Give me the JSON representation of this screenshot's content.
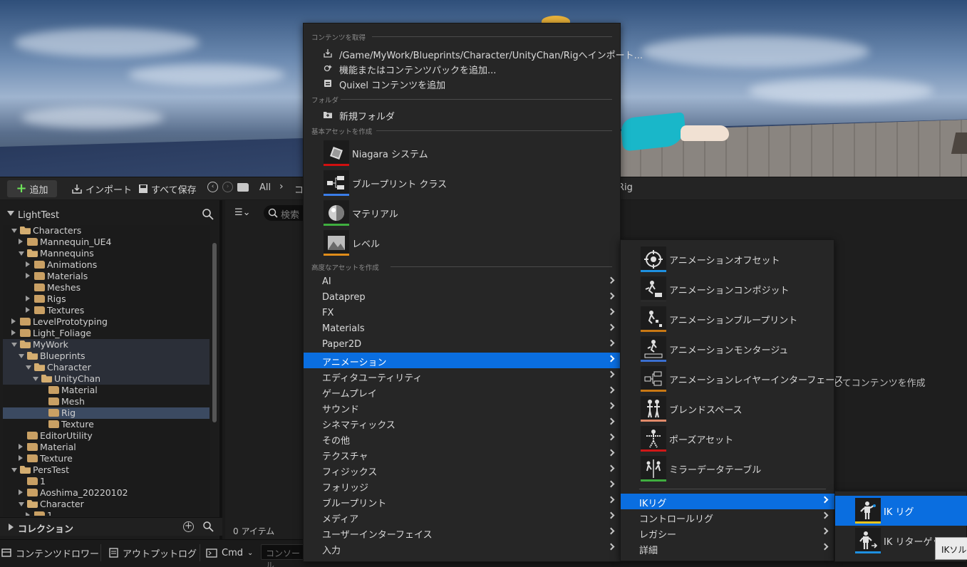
{
  "toolbar": {
    "add_label": "追加",
    "import_label": "インポート",
    "save_all_label": "すべて保存",
    "path_all": "All",
    "path_partial": "コ",
    "path_rig": "Rig"
  },
  "sidebar": {
    "title": "LightTest",
    "tree": [
      {
        "label": "Characters",
        "depth": 2,
        "expander": "down",
        "open": true
      },
      {
        "label": "Mannequin_UE4",
        "depth": 3,
        "expander": "right"
      },
      {
        "label": "Mannequins",
        "depth": 3,
        "expander": "down",
        "open": true
      },
      {
        "label": "Animations",
        "depth": 4,
        "expander": "right"
      },
      {
        "label": "Materials",
        "depth": 4,
        "expander": "right"
      },
      {
        "label": "Meshes",
        "depth": 4,
        "expander": "none"
      },
      {
        "label": "Rigs",
        "depth": 4,
        "expander": "right"
      },
      {
        "label": "Textures",
        "depth": 4,
        "expander": "right"
      },
      {
        "label": "LevelPrototyping",
        "depth": 2,
        "expander": "right"
      },
      {
        "label": "Light_Foliage",
        "depth": 2,
        "expander": "right"
      },
      {
        "label": "MyWork",
        "depth": 2,
        "expander": "down",
        "open": true,
        "highlight": true
      },
      {
        "label": "Blueprints",
        "depth": 3,
        "expander": "down",
        "open": true,
        "highlight": true
      },
      {
        "label": "Character",
        "depth": 4,
        "expander": "down",
        "open": true,
        "highlight": true
      },
      {
        "label": "UnityChan",
        "depth": 5,
        "expander": "down",
        "open": true,
        "highlight": true
      },
      {
        "label": "Material",
        "depth": 6,
        "expander": "none"
      },
      {
        "label": "Mesh",
        "depth": 6,
        "expander": "none"
      },
      {
        "label": "Rig",
        "depth": 6,
        "expander": "none",
        "selected": true
      },
      {
        "label": "Texture",
        "depth": 6,
        "expander": "none"
      },
      {
        "label": "EditorUtility",
        "depth": 3,
        "expander": "none"
      },
      {
        "label": "Material",
        "depth": 3,
        "expander": "right"
      },
      {
        "label": "Texture",
        "depth": 3,
        "expander": "right"
      },
      {
        "label": "PersTest",
        "depth": 2,
        "expander": "down",
        "open": true
      },
      {
        "label": "1",
        "depth": 3,
        "expander": "none"
      },
      {
        "label": "Aoshima_20220102",
        "depth": 3,
        "expander": "right"
      },
      {
        "label": "Character",
        "depth": 3,
        "expander": "down",
        "open": true
      },
      {
        "label": "1",
        "depth": 4,
        "expander": "right"
      }
    ],
    "collection_label": "コレクション"
  },
  "content": {
    "search_placeholder": "検索",
    "items_count": "0 アイテム",
    "bg_hint": "してコンテンツを作成"
  },
  "statusbar": {
    "drawer_label": "コンテンツドロワー",
    "output_log_label": "アウトプットログ",
    "cmd_label": "Cmd",
    "console_placeholder": "コンソール"
  },
  "menu_main": {
    "sec_get": "コンテンツを取得",
    "import_path": "/Game/MyWork/Blueprints/Character/UnityChan/Rigへインポート...",
    "add_feature": "機能またはコンテンツパックを追加...",
    "add_quixel": "Quixel コンテンツを追加",
    "sec_folder": "フォルダ",
    "new_folder": "新規フォルダ",
    "sec_basic": "基本アセットを作成",
    "basic_assets": [
      {
        "label": "Niagara システム",
        "icon": "niagara-icon",
        "color": "#d01010"
      },
      {
        "label": "ブループリント クラス",
        "icon": "blueprint-icon",
        "color": "#3a7de8"
      },
      {
        "label": "マテリアル",
        "icon": "material-icon",
        "color": "#3fae3f"
      },
      {
        "label": "レベル",
        "icon": "level-icon",
        "color": "#e08c1a"
      }
    ],
    "sec_advanced": "高度なアセットを作成",
    "advanced": [
      "AI",
      "Dataprep",
      "FX",
      "Materials",
      "Paper2D",
      "アニメーション",
      "エディタユーティリティ",
      "ゲームプレイ",
      "サウンド",
      "シネマティックス",
      "その他",
      "テクスチャ",
      "フィジックス",
      "フォリッジ",
      "ブループリント",
      "メディア",
      "ユーザーインターフェイス",
      "入力"
    ],
    "active_index": 5
  },
  "menu_anim": {
    "assets": [
      {
        "label": "アニメーションオフセット",
        "icon": "aim-offset-icon",
        "color": "#1e90e0"
      },
      {
        "label": "アニメーションコンポジット",
        "icon": "anim-composite-icon",
        "color": "#2a2a2a"
      },
      {
        "label": "アニメーションブループリント",
        "icon": "anim-blueprint-icon",
        "color": "#c87814"
      },
      {
        "label": "アニメーションモンタージュ",
        "icon": "anim-montage-icon",
        "color": "#3a6fd0"
      },
      {
        "label": "アニメーションレイヤーインターフェース",
        "icon": "anim-layer-interface-icon",
        "color": "#c87814"
      },
      {
        "label": "ブレンドスペース",
        "icon": "blend-space-icon",
        "color": "#e08a6a"
      },
      {
        "label": "ポーズアセット",
        "icon": "pose-asset-icon",
        "color": "#d01818"
      },
      {
        "label": "ミラーデータテーブル",
        "icon": "mirror-table-icon",
        "color": "#3fae3f"
      }
    ],
    "submenus": [
      "IKリグ",
      "コントロールリグ",
      "レガシー",
      "詳細"
    ],
    "active_index": 0
  },
  "menu_ik": {
    "items": [
      {
        "label": "IK リグ",
        "icon": "ik-rig-icon",
        "color": "#e8c420"
      },
      {
        "label": "IK リターゲッ",
        "icon": "ik-retargeter-icon",
        "color": "#1e90e0"
      }
    ]
  },
  "tooltip": "IKソル",
  "colors": {
    "accent": "#0a6ee0",
    "add_green": "#6ee35a",
    "folder": "#c9a064"
  }
}
